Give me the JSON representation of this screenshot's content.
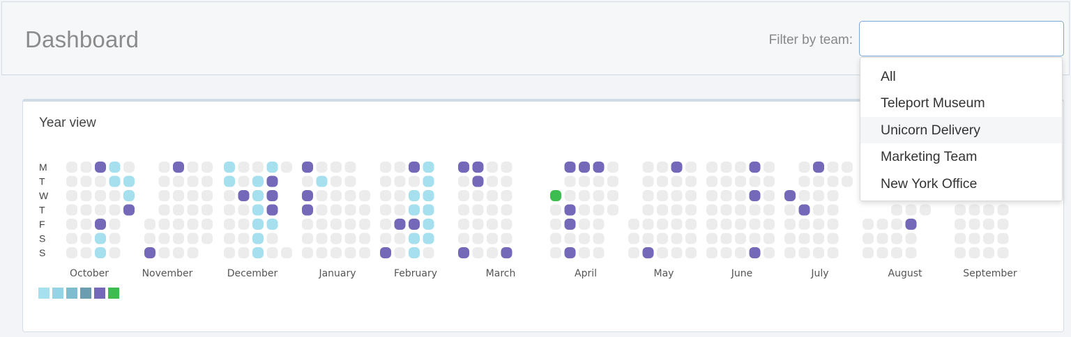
{
  "header": {
    "title": "Dashboard",
    "filter_label": "Filter by team:",
    "filter_value": "",
    "filter_placeholder": ""
  },
  "dropdown": {
    "options": [
      "All",
      "Teleport Museum",
      "Unicorn Delivery",
      "Marketing Team",
      "New York Office"
    ],
    "highlighted": "Unicorn Delivery"
  },
  "panel": {
    "title": "Year view"
  },
  "heatmap": {
    "day_labels": [
      "M",
      "T",
      "W",
      "T",
      "F",
      "S",
      "S"
    ],
    "months": [
      "October",
      "November",
      "December",
      "January",
      "February",
      "March",
      "April",
      "May",
      "June",
      "July",
      "August",
      "September"
    ],
    "colors": {
      "empty": "#ececec",
      "level1": "#a6e0ee",
      "level2": "#93d4e6",
      "level3": "#7fbccf",
      "level4": "#6b9db1",
      "level5": "#7468b9",
      "level6": "#3dbd4f"
    },
    "legend_levels": [
      "level1",
      "level2",
      "level3",
      "level4",
      "level5",
      "level6"
    ],
    "month_grids": [
      {
        "start_day": 0,
        "cells": [
          "e",
          "e",
          "p",
          "c",
          "e",
          "e",
          "e",
          "e",
          "c",
          "c",
          "e",
          "e",
          "e",
          "e",
          "c",
          "e",
          "e",
          "e",
          "e",
          "p",
          "e",
          "e",
          "p",
          "e",
          "",
          "e",
          "e",
          "c",
          "e",
          "",
          "e",
          "e",
          "c",
          "e",
          ""
        ]
      },
      {
        "start_day": 0,
        "cells": [
          "",
          "e",
          "p",
          "e",
          "e",
          "",
          "e",
          "e",
          "e",
          "e",
          "",
          "e",
          "e",
          "e",
          "e",
          "",
          "e",
          "e",
          "e",
          "e",
          "e",
          "e",
          "e",
          "e",
          "e",
          "e",
          "e",
          "e",
          "e",
          "e",
          "p",
          "e",
          "e",
          "e",
          ""
        ]
      },
      {
        "start_day": 0,
        "cells": [
          "c",
          "e",
          "e",
          "c",
          "e",
          "c",
          "e",
          "c",
          "p",
          "",
          "e",
          "p",
          "c",
          "p",
          "",
          "e",
          "e",
          "c",
          "p",
          "",
          "e",
          "e",
          "c",
          "c",
          "",
          "e",
          "e",
          "c",
          "e",
          "",
          "e",
          "e",
          "c",
          "e",
          "e"
        ]
      },
      {
        "start_day": 0,
        "cells": [
          "p",
          "e",
          "e",
          "e",
          "",
          "e",
          "c",
          "e",
          "e",
          "",
          "p",
          "e",
          "e",
          "e",
          "e",
          "p",
          "e",
          "e",
          "e",
          "e",
          "e",
          "e",
          "e",
          "e",
          "e",
          "e",
          "e",
          "e",
          "e",
          "e",
          "e",
          "e",
          "e",
          "e",
          "e"
        ]
      },
      {
        "start_day": 0,
        "cells": [
          "e",
          "e",
          "p",
          "c",
          "",
          "e",
          "e",
          "e",
          "c",
          "",
          "e",
          "e",
          "c",
          "c",
          "",
          "e",
          "e",
          "c",
          "c",
          "",
          "e",
          "p",
          "p",
          "c",
          "",
          "e",
          "e",
          "c",
          "c",
          "",
          "p",
          "e",
          "c",
          "e",
          ""
        ]
      },
      {
        "start_day": 0,
        "cells": [
          "p",
          "p",
          "e",
          "e",
          "",
          "e",
          "p",
          "e",
          "e",
          "",
          "e",
          "e",
          "e",
          "e",
          "",
          "e",
          "e",
          "e",
          "e",
          "",
          "e",
          "e",
          "e",
          "e",
          "",
          "e",
          "e",
          "e",
          "e",
          "",
          "p",
          "e",
          "e",
          "p",
          ""
        ]
      },
      {
        "start_day": 0,
        "cells": [
          "",
          "p",
          "p",
          "p",
          "e",
          "",
          "e",
          "e",
          "e",
          "e",
          "g",
          "e",
          "e",
          "e",
          "e",
          "e",
          "p",
          "e",
          "e",
          "e",
          "e",
          "p",
          "e",
          "e",
          "",
          "e",
          "e",
          "e",
          "e",
          "",
          "e",
          "p",
          "e",
          "e",
          ""
        ]
      },
      {
        "start_day": 0,
        "cells": [
          "",
          "e",
          "e",
          "p",
          "e",
          "",
          "e",
          "e",
          "e",
          "e",
          "",
          "e",
          "e",
          "e",
          "e",
          "",
          "e",
          "e",
          "e",
          "e",
          "e",
          "e",
          "e",
          "e",
          "e",
          "e",
          "e",
          "e",
          "e",
          "e",
          "e",
          "p",
          "e",
          "e",
          "e"
        ]
      },
      {
        "start_day": 0,
        "cells": [
          "e",
          "e",
          "e",
          "p",
          "e",
          "e",
          "e",
          "e",
          "e",
          "e",
          "e",
          "e",
          "e",
          "p",
          "e",
          "e",
          "e",
          "e",
          "e",
          "e",
          "e",
          "e",
          "e",
          "e",
          "e",
          "e",
          "e",
          "e",
          "e",
          "e",
          "e",
          "e",
          "e",
          "p",
          "e"
        ]
      },
      {
        "start_day": 0,
        "cells": [
          "",
          "e",
          "p",
          "e",
          "e",
          "",
          "e",
          "e",
          "e",
          "e",
          "p",
          "e",
          "e",
          "e",
          "",
          "e",
          "p",
          "e",
          "e",
          "",
          "e",
          "e",
          "e",
          "e",
          "",
          "e",
          "e",
          "e",
          "e",
          "",
          "e",
          "e",
          "e",
          "e",
          ""
        ]
      },
      {
        "start_day": 0,
        "cells": [
          "",
          "",
          "e",
          "e",
          "e",
          "",
          "",
          "e",
          "e",
          "e",
          "",
          "",
          "e",
          "e",
          "e",
          "",
          "",
          "e",
          "e",
          "e",
          "e",
          "e",
          "e",
          "p",
          "",
          "e",
          "e",
          "e",
          "e",
          "",
          "e",
          "e",
          "e",
          "e",
          ""
        ]
      },
      {
        "start_day": 0,
        "cells": [
          "e",
          "e",
          "e",
          "e",
          "",
          "e",
          "e",
          "e",
          "e",
          "",
          "e",
          "e",
          "e",
          "e",
          "",
          "e",
          "e",
          "e",
          "e",
          "",
          "e",
          "e",
          "e",
          "e",
          "",
          "e",
          "e",
          "e",
          "e",
          "",
          "e",
          "e",
          "e",
          "e",
          ""
        ]
      }
    ]
  }
}
